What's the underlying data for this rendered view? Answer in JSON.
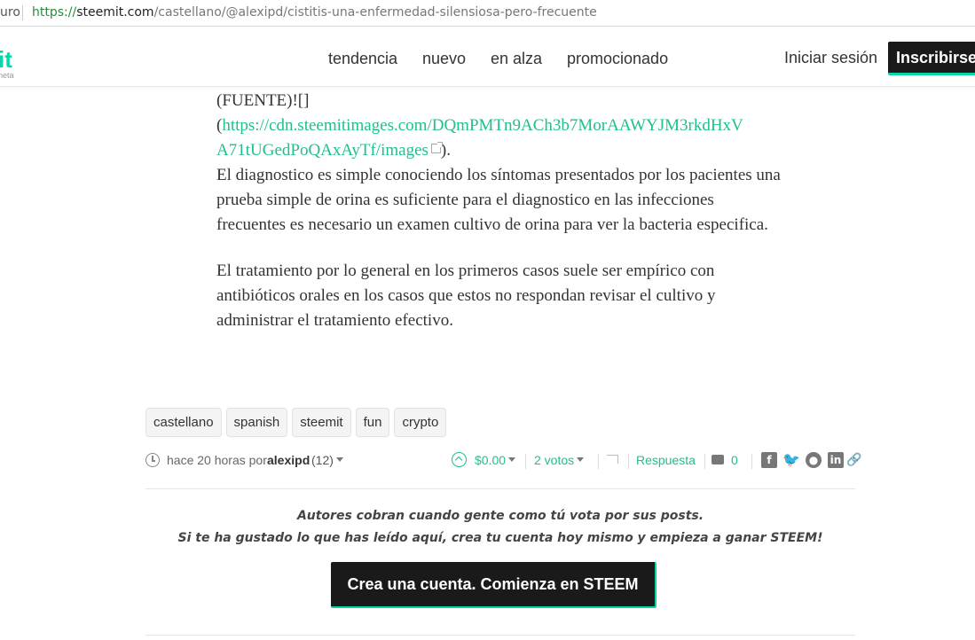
{
  "browser": {
    "secure_label": "uro",
    "url_scheme": "https://",
    "url_host": "steemit.com",
    "url_path": "/castellano/@alexipd/cistitis-una-enfermedad-silensiosa-pero-frecuente"
  },
  "header": {
    "logo_text": "it",
    "logo_sub": "neta",
    "nav": [
      "tendencia",
      "nuevo",
      "en alza",
      "promocionado"
    ],
    "login_label": "Iniciar sesión",
    "signup_label": "Inscribirse"
  },
  "article": {
    "source_prefix": "(FUENTE)![]",
    "source_open": "(",
    "source_link_line1": "https://cdn.steemitimages.com/DQmPMTn9ACh3b7MorAAWYJM3rkdHxV",
    "source_link_line2": "A71tUGedPoQAxAyTf/images",
    "source_close": ").",
    "p1": "El diagnostico es simple conociendo los síntomas presentados por los pacientes una prueba simple de orina es suficiente para el diagnostico en las infecciones frecuentes es necesario un examen cultivo de orina para ver la bacteria especifica.",
    "p2": "El tratamiento por lo general en los primeros casos suele ser empírico con antibióticos orales en los casos que estos no respondan revisar el cultivo y administrar el tratamiento efectivo."
  },
  "tags": [
    "castellano",
    "spanish",
    "steemit",
    "fun",
    "crypto"
  ],
  "meta": {
    "time": "hace 20 horas por",
    "author": "alexipd",
    "reputation": "(12)",
    "payout": "$0.00",
    "votes": "2 votos",
    "reply": "Respuesta",
    "comments": "0"
  },
  "share_icons": [
    "facebook-icon",
    "twitter-icon",
    "reddit-icon",
    "linkedin-icon",
    "link-icon"
  ],
  "promo": {
    "line1": "Autores cobran cuando gente como tú vota por sus posts.",
    "line2": "Si te ha gustado lo que has leído aquí, crea tu cuenta hoy mismo y empieza a ganar STEEM!",
    "cta": "Crea una cuenta. Comienza en STEEM"
  },
  "colors": {
    "accent": "#06d6a9",
    "link": "#1fbf8f",
    "dark_button": "#1a1a1a"
  }
}
